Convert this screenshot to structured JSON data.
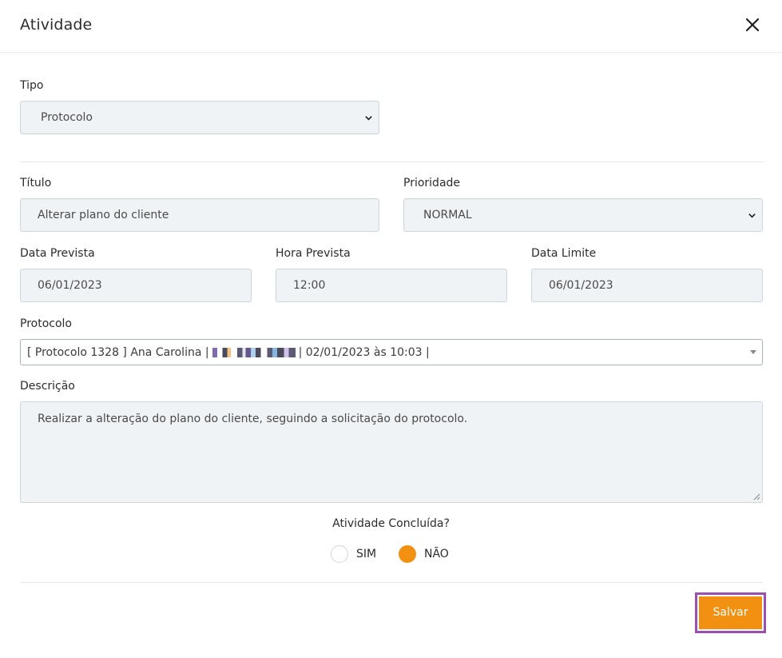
{
  "modal": {
    "title": "Atividade"
  },
  "form": {
    "tipo": {
      "label": "Tipo",
      "value": "Protocolo"
    },
    "titulo": {
      "label": "Título",
      "value": "Alterar plano do cliente"
    },
    "prioridade": {
      "label": "Prioridade",
      "value": "NORMAL"
    },
    "data_prevista": {
      "label": "Data Prevista",
      "value": "06/01/2023"
    },
    "hora_prevista": {
      "label": "Hora Prevista",
      "value": "12:00"
    },
    "data_limite": {
      "label": "Data Limite",
      "value": "06/01/2023"
    },
    "protocolo": {
      "label": "Protocolo",
      "value_prefix": "[ Protocolo 1328 ] Ana Carolina |",
      "value_suffix": "| 02/01/2023 às 10:03 |"
    },
    "descricao": {
      "label": "Descrição",
      "value": "Realizar a alteração do plano do cliente, seguindo a solicitação do protocolo."
    },
    "concluida": {
      "label": "Atividade Concluída?",
      "options": [
        {
          "label": "SIM",
          "selected": false
        },
        {
          "label": "NÃO",
          "selected": true
        }
      ]
    }
  },
  "footer": {
    "save_label": "Salvar"
  },
  "colors": {
    "accent": "#f29111",
    "highlight_border": "#9b4fb0",
    "field_bg": "#f0f3f6"
  },
  "icons": {
    "close": "close-icon",
    "select_chevron": "chevron-down-icon"
  }
}
